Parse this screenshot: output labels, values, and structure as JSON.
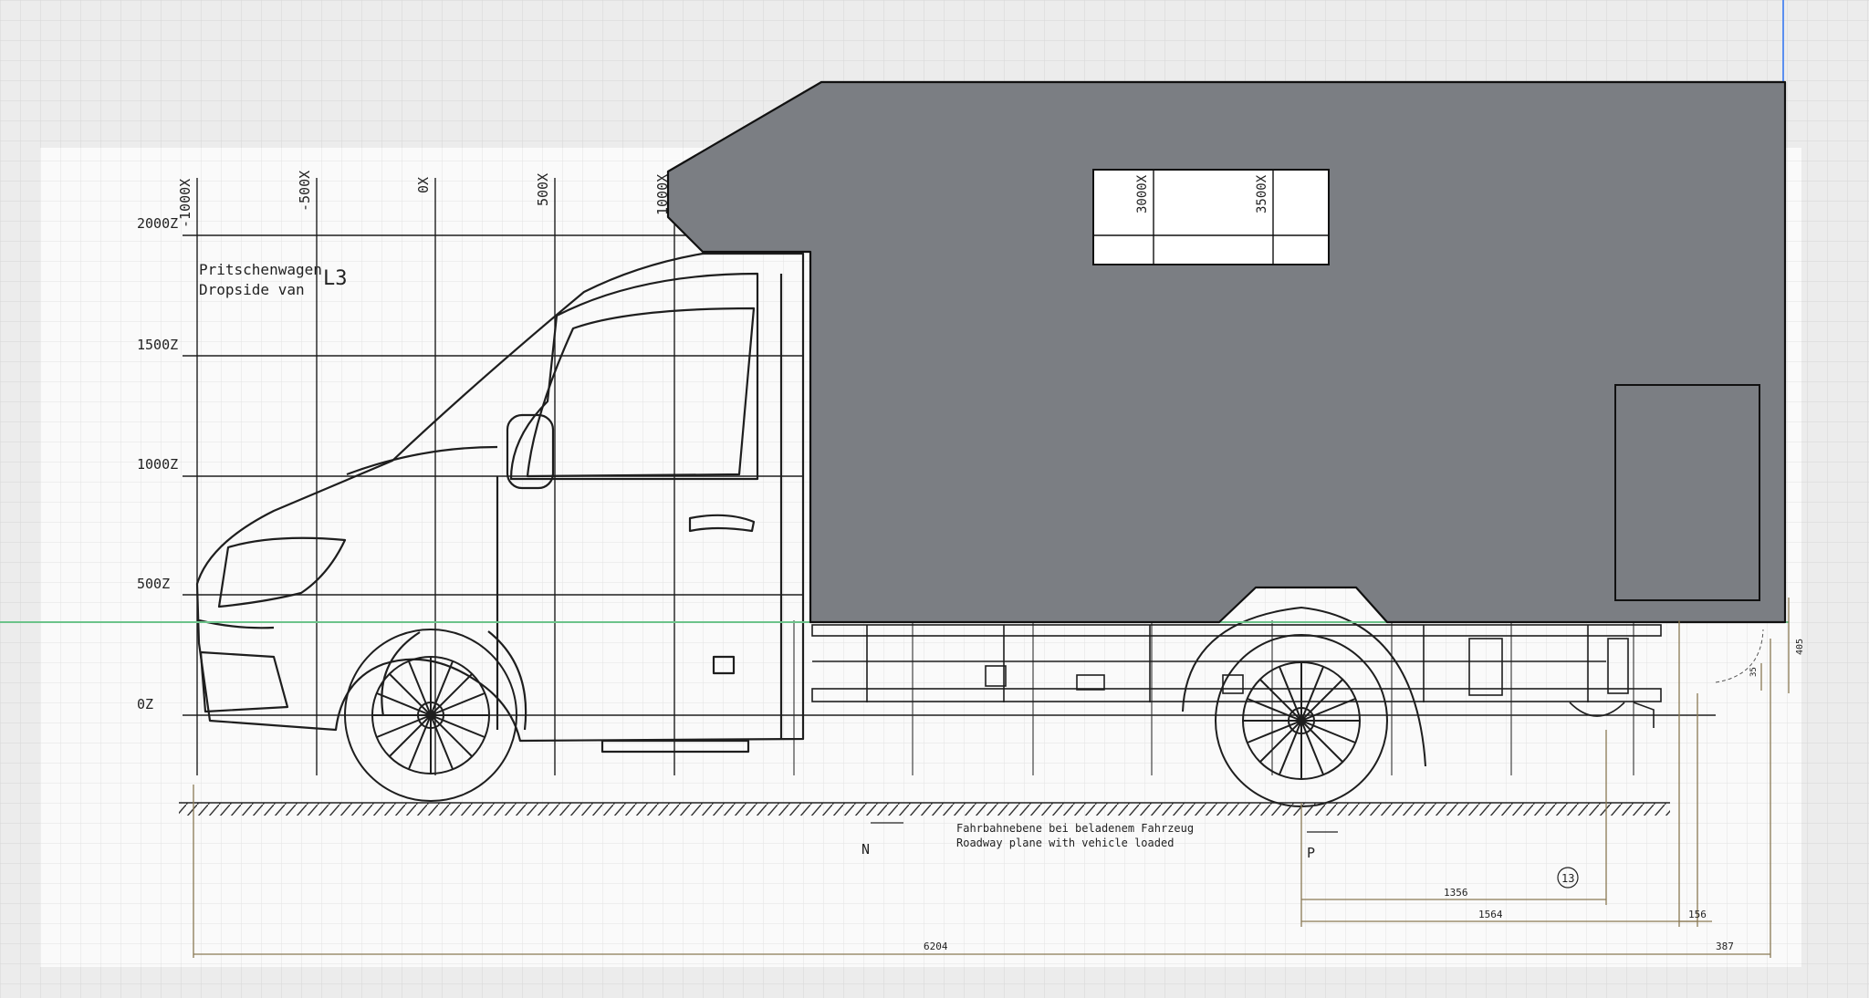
{
  "colors": {
    "grid_bg": "#ececec",
    "grid_line": "#d2d2d2",
    "sheet": "#ffffff",
    "ink": "#1e1e1e",
    "dim_line": "#8a7a55",
    "camper_fill": "#7b7e83",
    "guide_green": "#6cc38a",
    "guide_blue": "#5b8ff0"
  },
  "drawing": {
    "x_ticks": [
      "-1000X",
      "-500X",
      "0X",
      "500X",
      "1000X"
    ],
    "z_ticks": [
      "2000Z",
      "1500Z",
      "1000Z",
      "500Z",
      "0Z"
    ],
    "window_ticks": [
      "3000X",
      "3500X"
    ],
    "title_de": "Pritschenwagen",
    "title_en": "Dropside van",
    "variant": "L3",
    "marker_n": "N",
    "marker_p": "P",
    "roadway_de": "Fahrbahnebene bei beladenem Fahrzeug",
    "roadway_en": "Roadway plane with vehicle loaded",
    "circled_ref": "13",
    "dims": {
      "overall": "6204",
      "d1356": "1356",
      "d1564": "1564",
      "d156": "156",
      "d387": "387",
      "d405": "405",
      "d35": "35"
    }
  }
}
